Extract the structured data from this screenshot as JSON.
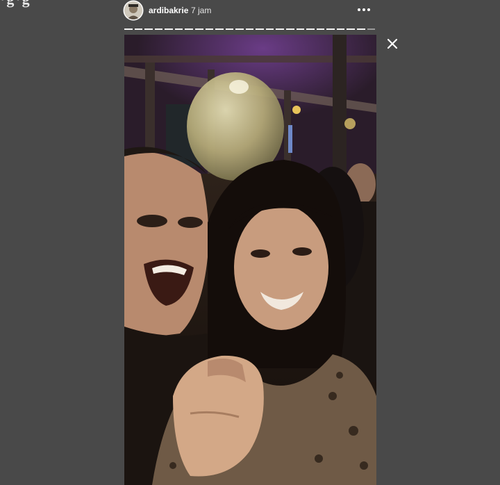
{
  "brand_fragment": "·g·g",
  "story": {
    "username": "ardibakrie",
    "timestamp": "7 jam",
    "segments_total": 25,
    "segments_viewed": 24
  },
  "icons": {
    "more": "more-horizontal-icon",
    "close": "close-icon",
    "avatar": "avatar-image"
  },
  "colors": {
    "page_background": "#494949",
    "text_primary": "#ffffff",
    "progress_active": "#f4f4f4",
    "progress_inactive": "rgba(255,255,255,0.45)"
  }
}
